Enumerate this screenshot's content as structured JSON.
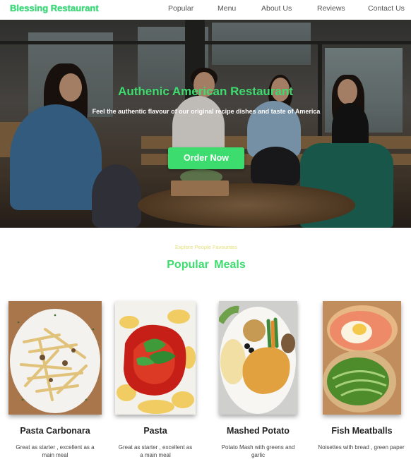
{
  "nav": {
    "brand": "Blessing Restaurant",
    "links": [
      "Popular",
      "Menu",
      "About Us",
      "Reviews",
      "Contact Us"
    ]
  },
  "hero": {
    "title": "Authenic American Restaurant",
    "subtitle": "Feel the authentic  flavour of our original recipe dishes and taste of America",
    "cta": "Order Now"
  },
  "popular": {
    "eyebrow": "Explore People Favourites",
    "title": "Popular  Meals",
    "meals": [
      {
        "name": "Pasta Carbonara",
        "desc": "Great as starter , excellent as a main meal"
      },
      {
        "name": "Pasta",
        "desc": "Great as starter , excellent as a main meal"
      },
      {
        "name": "Mashed Potato",
        "desc": "Potato Mash with greens and garlic"
      },
      {
        "name": "Fish Meatballs",
        "desc": "Noisettes with bread , green paper"
      }
    ]
  },
  "colors": {
    "accent": "#3ddc6e",
    "eyebrow": "#e6df7a"
  }
}
